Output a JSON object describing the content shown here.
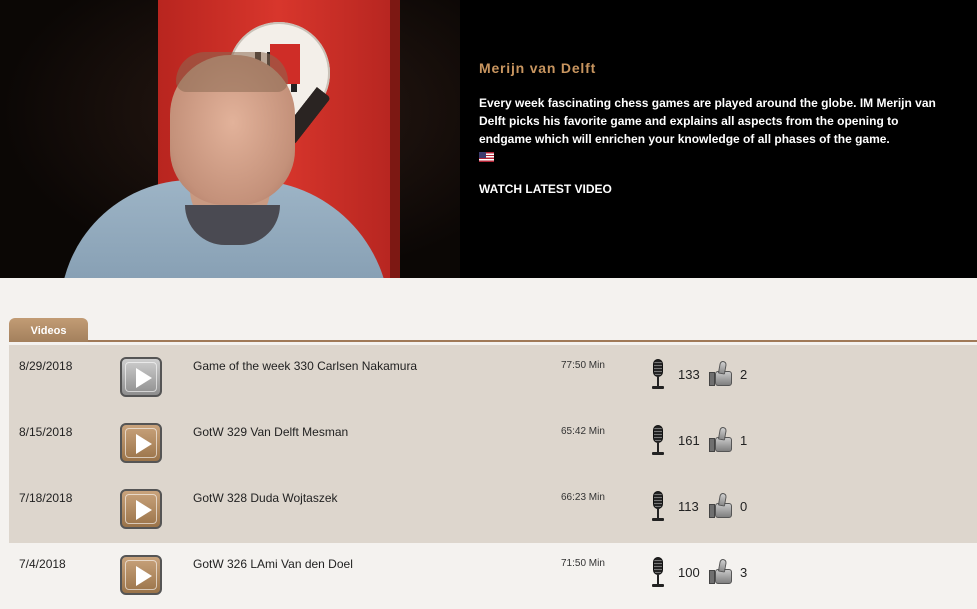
{
  "hero": {
    "title": "Merijn van Delft",
    "description": "Every week fascinating chess games are played around the globe. IM Merijn van Delft picks his favorite game and explains all aspects from the opening to endgame which will enrichen your knowledge of all phases of the game.",
    "flag": "us-flag-icon",
    "watch_label": "WATCH LATEST VIDEO"
  },
  "tabs": {
    "videos_label": "Videos"
  },
  "videos": [
    {
      "date": "8/29/2018",
      "title": "Game of the week 330 Carlsen Nakamura",
      "duration": "77:50 Min",
      "listens": "133",
      "likes": "2",
      "play_style": "gray"
    },
    {
      "date": "8/15/2018",
      "title": "GotW 329 Van Delft Mesman",
      "duration": "65:42 Min",
      "listens": "161",
      "likes": "1",
      "play_style": "bronze"
    },
    {
      "date": "7/18/2018",
      "title": "GotW 328 Duda Wojtaszek",
      "duration": "66:23 Min",
      "listens": "113",
      "likes": "0",
      "play_style": "bronze"
    },
    {
      "date": "7/4/2018",
      "title": "GotW 326 LAmi Van den Doel",
      "duration": "71:50 Min",
      "listens": "100",
      "likes": "3",
      "play_style": "bronze"
    }
  ],
  "colors": {
    "accent": "#c8955f",
    "row_alt": "#ddd6cd",
    "tab": "#b08a66"
  }
}
